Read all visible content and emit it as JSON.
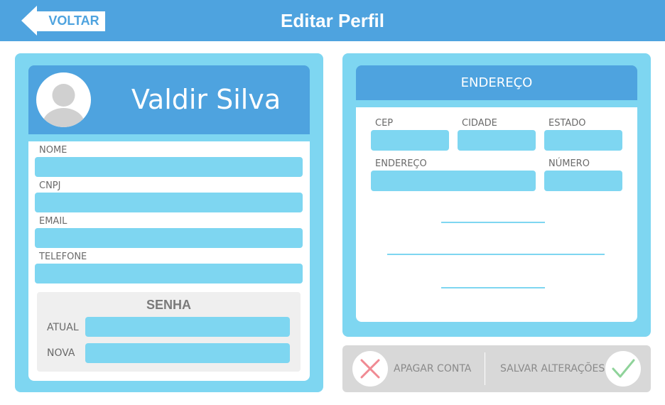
{
  "header": {
    "back_label": "VOLTAR",
    "title": "Editar Perfil"
  },
  "profile": {
    "name": "Valdir Silva",
    "fields": [
      {
        "label": "NOME",
        "value": ""
      },
      {
        "label": "CNPJ",
        "value": ""
      },
      {
        "label": "EMAIL",
        "value": ""
      },
      {
        "label": "TELEFONE",
        "value": ""
      }
    ],
    "password": {
      "title": "SENHA",
      "current_label": "ATUAL",
      "new_label": "NOVA"
    }
  },
  "address": {
    "title": "ENDEREÇO",
    "cep_label": "CEP",
    "city_label": "CIDADE",
    "state_label": "ESTADO",
    "street_label": "ENDEREÇO",
    "number_label": "NÚMERO"
  },
  "actions": {
    "delete_label": "APAGAR CONTA",
    "save_label": "SALVAR ALTERAÇÕES"
  },
  "colors": {
    "header_blue": "#4ea3df",
    "field_cyan": "#7ed6f1",
    "delete_icon": "#f08a93",
    "save_icon": "#8fd39a"
  },
  "icons": {
    "back": "arrow-left-icon",
    "avatar": "user-silhouette-icon",
    "delete": "x-icon",
    "save": "check-icon"
  }
}
